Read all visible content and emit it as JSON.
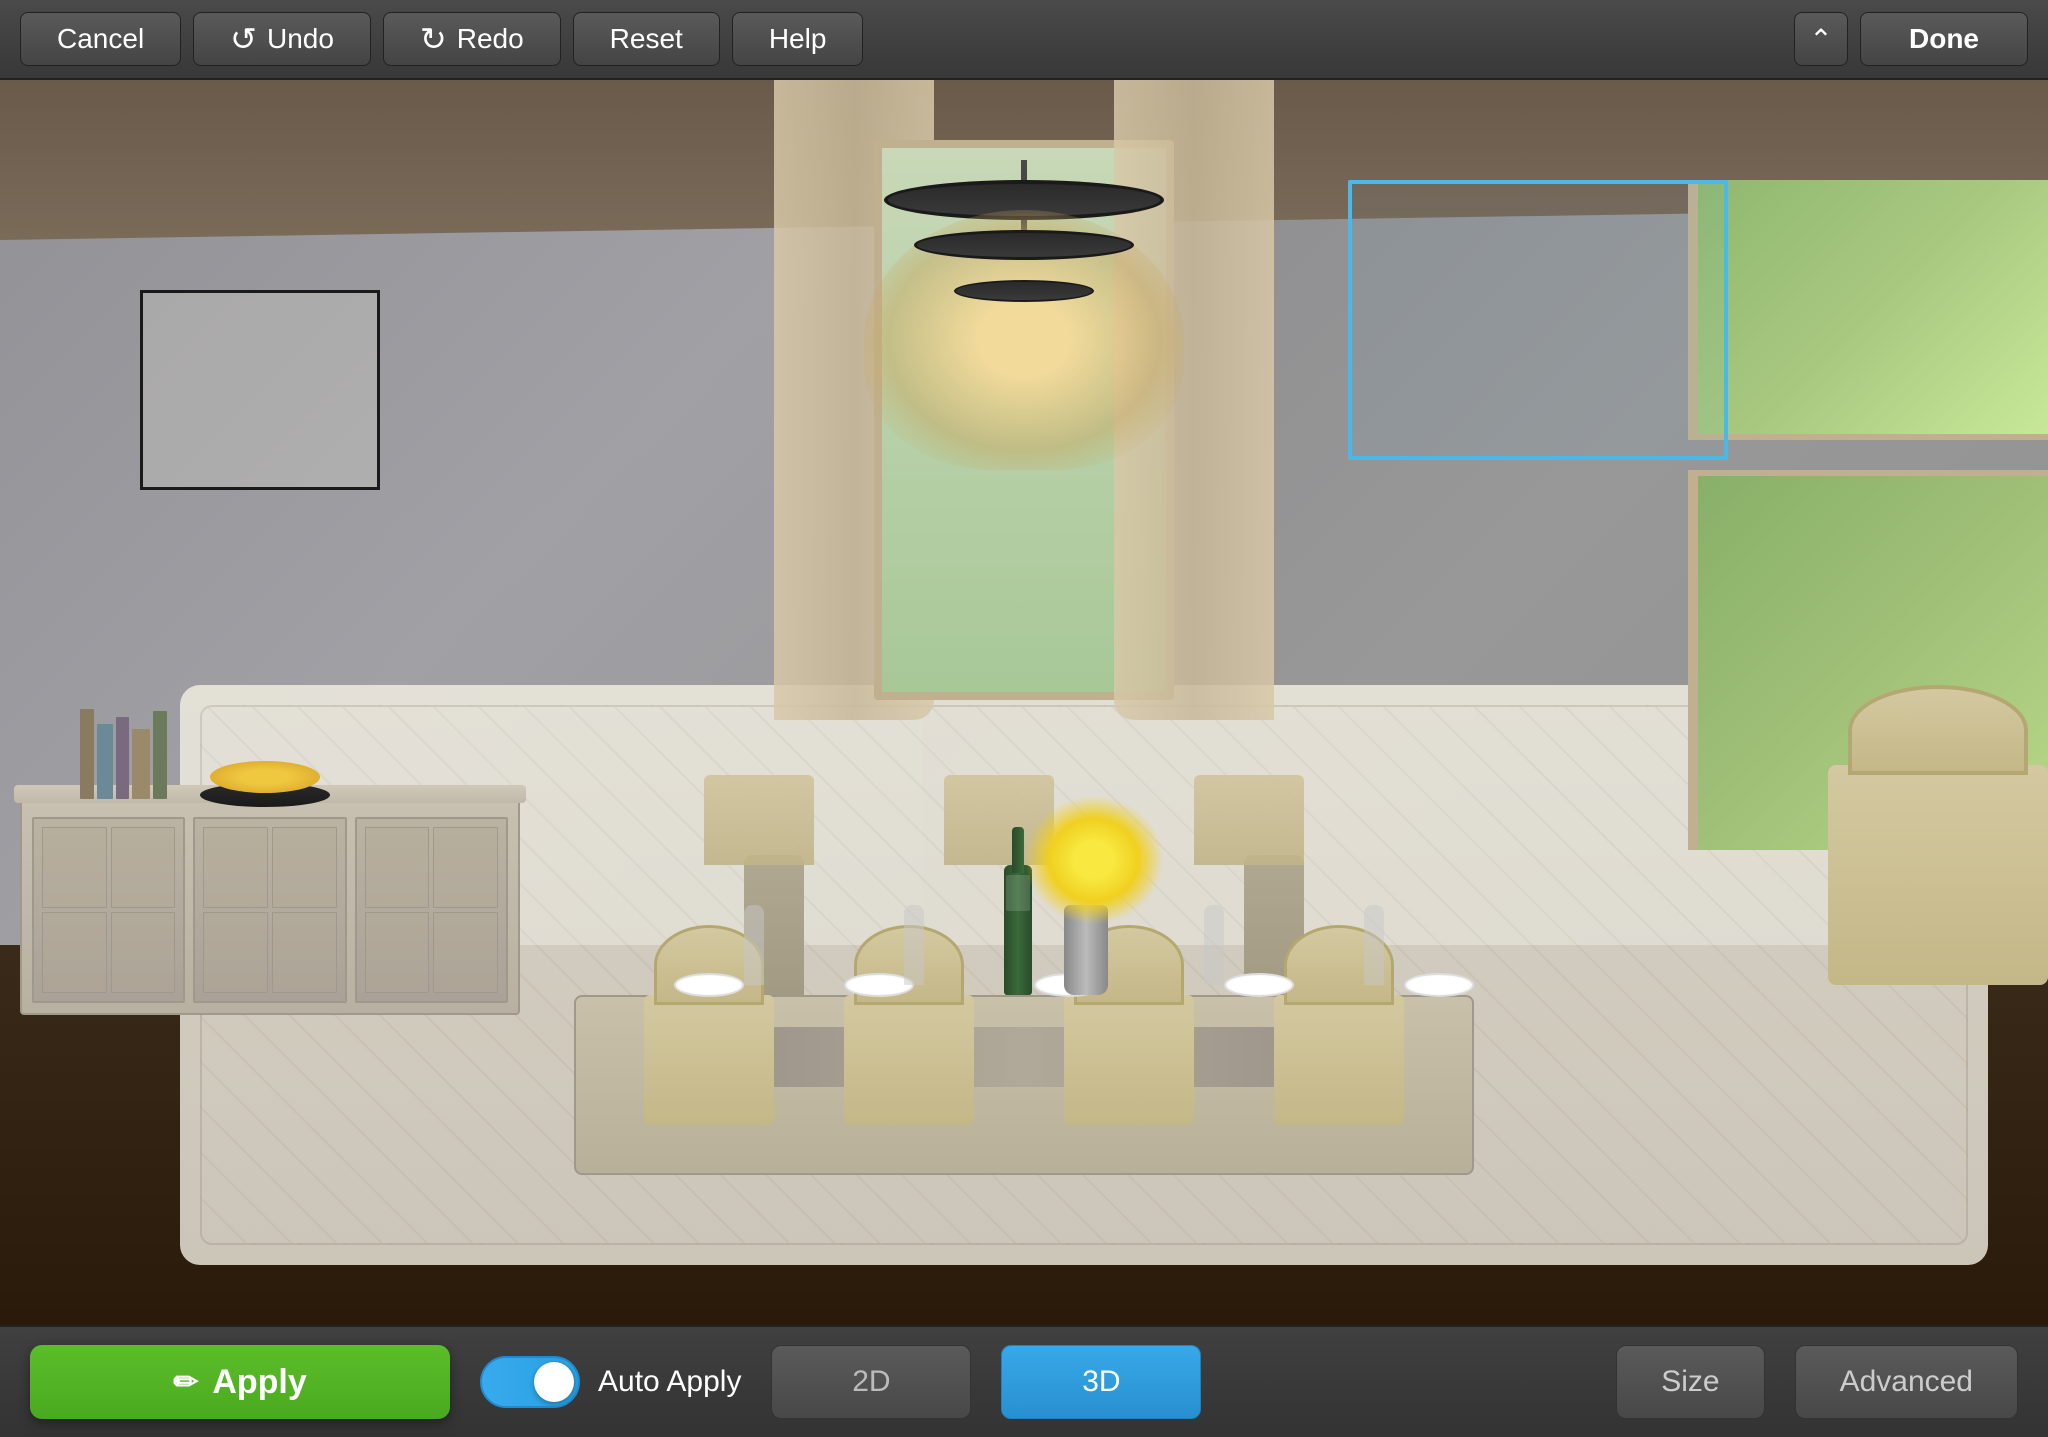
{
  "toolbar": {
    "cancel_label": "Cancel",
    "undo_label": "Undo",
    "redo_label": "Redo",
    "reset_label": "Reset",
    "help_label": "Help",
    "done_label": "Done",
    "collapse_icon": "⌃"
  },
  "bottom_toolbar": {
    "apply_label": "Apply",
    "apply_icon": "✏",
    "auto_apply_label": "Auto Apply",
    "mode_2d_label": "2D",
    "mode_3d_label": "3D",
    "size_label": "Size",
    "advanced_label": "Advanced"
  },
  "scene": {
    "description": "3D dining room scene with chandelier, dining table, chairs, and sideboard"
  }
}
